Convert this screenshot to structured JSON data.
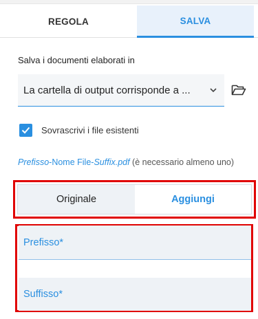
{
  "tabs": [
    {
      "label": "REGOLA",
      "active": false
    },
    {
      "label": "SALVA",
      "active": true
    }
  ],
  "save_section": {
    "label": "Salva i documenti elaborati in",
    "selected_option": "La cartella di output corrisponde a ...",
    "folder_icon": "folder-open-icon",
    "chevron_icon": "chevron-down-icon"
  },
  "overwrite": {
    "checked": true,
    "label": "Sovrascrivi i file esistenti"
  },
  "filename_hint": {
    "prefix": "Prefisso",
    "middle": "-Nome File-",
    "suffix": "Suffix",
    "ext": ".pdf",
    "note": " (è necessario almeno uno)"
  },
  "mode_toggle": {
    "options": [
      {
        "label": "Originale",
        "selected": false
      },
      {
        "label": "Aggiungi",
        "selected": true
      }
    ]
  },
  "fields": {
    "prefix_placeholder": "Prefisso*",
    "suffix_placeholder": "Suffisso*"
  },
  "colors": {
    "accent": "#2a8fe0",
    "highlight_box": "#e00000"
  }
}
